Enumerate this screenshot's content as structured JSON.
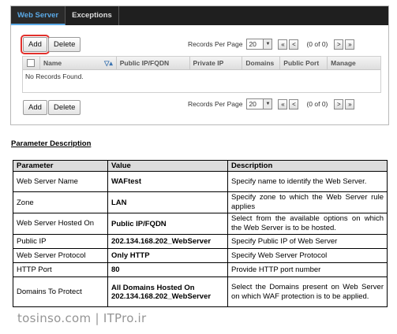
{
  "tabs": [
    {
      "label": "Web Server",
      "active": true
    },
    {
      "label": "Exceptions",
      "active": false
    }
  ],
  "toolbar_top": {
    "add_label": "Add",
    "delete_label": "Delete"
  },
  "toolbar_bottom": {
    "add_label": "Add",
    "delete_label": "Delete"
  },
  "pager_top": {
    "label": "Records Per Page",
    "per_page": "20",
    "info": "(0 of 0)",
    "first": "«",
    "prev": "<",
    "next": ">",
    "last": "»",
    "dropdown_arrow": "▼"
  },
  "pager_bottom": {
    "label": "Records Per Page",
    "per_page": "20",
    "info": "(0 of 0)",
    "first": "«",
    "prev": "<",
    "next": ">",
    "last": "»",
    "dropdown_arrow": "▼"
  },
  "grid": {
    "columns": [
      "Name",
      "Public IP/FQDN",
      "Private IP",
      "Domains",
      "Public Port",
      "Manage"
    ],
    "filter_icon": "▽▴",
    "empty_text": "No Records Found."
  },
  "doc": {
    "heading": "Parameter Description",
    "headers": [
      "Parameter",
      "Value",
      "Description"
    ],
    "rows": [
      {
        "parameter": "Web Server Name",
        "value": "WAFtest",
        "description": "Specify name to identify the Web Server."
      },
      {
        "parameter": "Zone",
        "value": "LAN",
        "description": "Specify zone to which the Web Server rule applies"
      },
      {
        "parameter": "Web Server Hosted On",
        "value": "Public IP/FQDN",
        "description": "Select from the available options on which the Web Server is to be hosted."
      },
      {
        "parameter": "Public IP",
        "value": "202.134.168.202_WebServer",
        "description": "Specify Public IP of Web Server"
      },
      {
        "parameter": "Web Server Protocol",
        "value": "Only HTTP",
        "description": "Specify Web Server Protocol"
      },
      {
        "parameter": "HTTP Port",
        "value": "80",
        "description": "Provide HTTP port number"
      },
      {
        "parameter": "Domains To Protect",
        "value": "All Domains Hosted On 202.134.168.202_WebServer",
        "description": "Select the Domains present on Web Server on which WAF protection is to be applied."
      }
    ]
  },
  "watermark": "tosinso.com  |  ITPro.ir"
}
